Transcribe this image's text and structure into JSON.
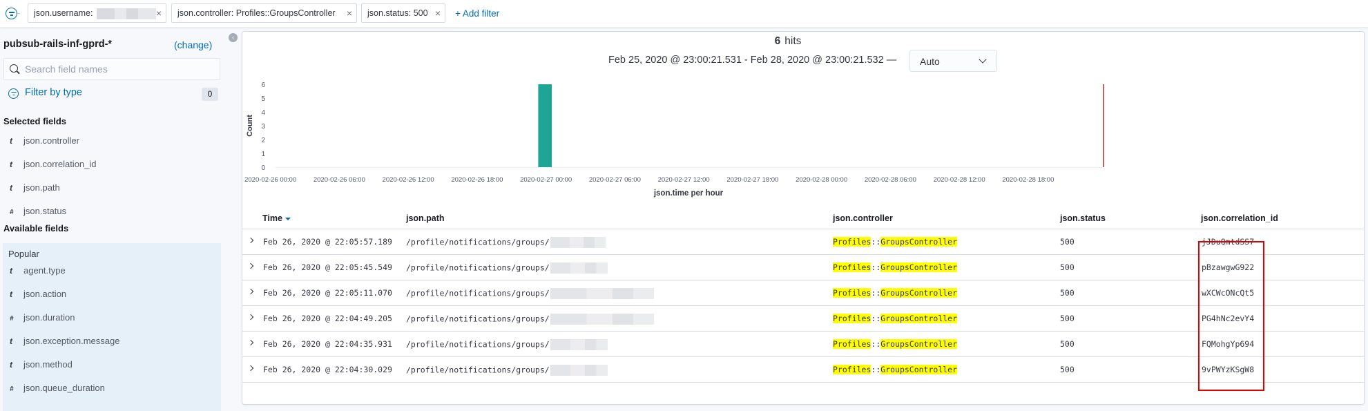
{
  "filter_bar": {
    "filters": [
      {
        "label": "json.username:",
        "value_redacted": true,
        "remove_icon": "close-icon"
      },
      {
        "label": "json.controller: Profiles::GroupsController",
        "value_redacted": false,
        "remove_icon": "close-icon"
      },
      {
        "label": "json.status: 500",
        "value_redacted": false,
        "remove_icon": "close-icon"
      }
    ],
    "add_filter_label": "+ Add filter",
    "close_glyph": "×"
  },
  "sidebar": {
    "index_pattern": "pubsub-rails-inf-gprd-*",
    "change_label": "(change)",
    "collapse_glyph": "‹",
    "search_placeholder": "Search field names",
    "search_value": "",
    "filter_by_type_label": "Filter by type",
    "filter_count": "0",
    "selected_fields_title": "Selected fields",
    "selected_fields": [
      {
        "type": "t",
        "name": "json.controller"
      },
      {
        "type": "t",
        "name": "json.correlation_id"
      },
      {
        "type": "t",
        "name": "json.path"
      },
      {
        "type": "#",
        "name": "json.status"
      }
    ],
    "available_fields_title": "Available fields",
    "popular_label": "Popular",
    "popular_fields": [
      {
        "type": "t",
        "name": "agent.type"
      },
      {
        "type": "t",
        "name": "json.action"
      },
      {
        "type": "#",
        "name": "json.duration"
      },
      {
        "type": "t",
        "name": "json.exception.message"
      },
      {
        "type": "t",
        "name": "json.method"
      },
      {
        "type": "#",
        "name": "json.queue_duration"
      }
    ]
  },
  "main": {
    "hits_count": "6",
    "hits_label": "hits",
    "time_range": "Feb 25, 2020 @ 23:00:21.531 - Feb 28, 2020 @ 23:00:21.532 —",
    "interval": "Auto",
    "colors": {
      "bar": "#1ea593",
      "now_marker": "#c8625f",
      "highlight": "#ffff00",
      "annotation_box": "#e30000",
      "link": "#006bb4"
    }
  },
  "chart_data": {
    "type": "bar",
    "title": "",
    "xlabel": "json.time per hour",
    "ylabel": "Count",
    "ylim": [
      0,
      6
    ],
    "yticks": [
      0,
      1,
      2,
      3,
      4,
      5,
      6
    ],
    "x_range_hours": [
      "2020-02-25 23:00",
      "2020-02-28 23:00"
    ],
    "xtick_labels": [
      "2020-02-26 00:00",
      "2020-02-26 06:00",
      "2020-02-26 12:00",
      "2020-02-26 18:00",
      "2020-02-27 00:00",
      "2020-02-27 06:00",
      "2020-02-27 12:00",
      "2020-02-27 18:00",
      "2020-02-28 00:00",
      "2020-02-28 06:00",
      "2020-02-28 12:00",
      "2020-02-28 18:00"
    ],
    "xtick_offsets_hours": [
      1,
      7,
      13,
      19,
      25,
      31,
      37,
      43,
      49,
      55,
      61,
      67
    ],
    "bars": [
      {
        "x": "2020-02-26 22:00",
        "offset_hours": 23,
        "value": 6
      }
    ],
    "now_marker_offset_hours": 72,
    "grid": false,
    "legend": "none"
  },
  "table": {
    "columns": [
      {
        "label": "Time",
        "sorted": "desc"
      },
      {
        "label": "json.path"
      },
      {
        "label": "json.controller"
      },
      {
        "label": "json.status"
      },
      {
        "label": "json.correlation_id"
      }
    ],
    "rows": [
      {
        "time": "Feb 26, 2020 @ 22:05:57.189",
        "path": "/profile/notifications/groups/",
        "controller_a": "Profiles",
        "controller_sep": "::",
        "controller_b": "GroupsController",
        "status": "500",
        "correlation_id": "jJDuQmtdSS7"
      },
      {
        "time": "Feb 26, 2020 @ 22:05:45.549",
        "path": "/profile/notifications/groups/",
        "controller_a": "Profiles",
        "controller_sep": "::",
        "controller_b": "GroupsController",
        "status": "500",
        "correlation_id": "pBzawgwG922"
      },
      {
        "time": "Feb 26, 2020 @ 22:05:11.070",
        "path": "/profile/notifications/groups/",
        "controller_a": "Profiles",
        "controller_sep": "::",
        "controller_b": "GroupsController",
        "status": "500",
        "correlation_id": "wXCWcONcQt5"
      },
      {
        "time": "Feb 26, 2020 @ 22:04:49.205",
        "path": "/profile/notifications/groups/",
        "controller_a": "Profiles",
        "controller_sep": "::",
        "controller_b": "GroupsController",
        "status": "500",
        "correlation_id": "PG4hNc2evY4"
      },
      {
        "time": "Feb 26, 2020 @ 22:04:35.931",
        "path": "/profile/notifications/groups/",
        "controller_a": "Profiles",
        "controller_sep": "::",
        "controller_b": "GroupsController",
        "status": "500",
        "correlation_id": "FQMohgYp694"
      },
      {
        "time": "Feb 26, 2020 @ 22:04:30.029",
        "path": "/profile/notifications/groups/",
        "controller_a": "Profiles",
        "controller_sep": "::",
        "controller_b": "GroupsController",
        "status": "500",
        "correlation_id": "9vPWYzKSgW8"
      }
    ]
  }
}
